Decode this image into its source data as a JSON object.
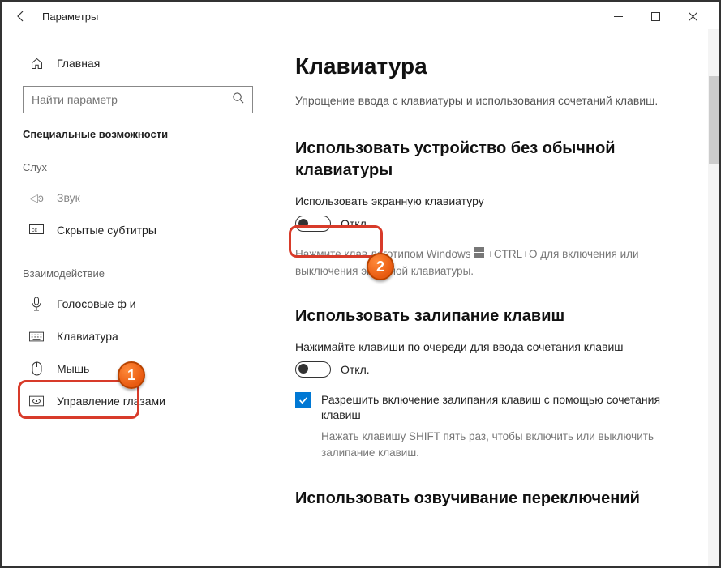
{
  "titlebar": {
    "title": "Параметры"
  },
  "sidebar": {
    "home": "Главная",
    "search_placeholder": "Найти параметр",
    "group": "Специальные возможности",
    "sections": {
      "hearing": "Слух",
      "interaction": "Взаимодействие"
    },
    "items": {
      "zvuk": "Звук",
      "captions": "Скрытые субтитры",
      "voice": "Голосовые ф        и",
      "keyboard": "Клавиатура",
      "mouse": "Мышь",
      "eye": "Управление глазами"
    }
  },
  "main": {
    "heading": "Клавиатура",
    "sub": "Упрощение ввода с клавиатуры и использования сочетаний клавиш.",
    "sec1": {
      "title": "Использовать устройство без обычной клавиатуры",
      "opt": "Использовать экранную клавиатуру",
      "toggle": "Откл.",
      "hint1": "Нажмите клав           логотипом Windows",
      "hint2": " +CTRL+O для включения или выключения экранной клавиатуры."
    },
    "sec2": {
      "title": "Использовать залипание клавиш",
      "opt": "Нажимайте клавиши по очереди для ввода сочетания клавиш",
      "toggle": "Откл.",
      "cb": "Разрешить включение залипания клавиш с помощью сочетания клавиш",
      "hint": "Нажать клавишу SHIFT пять раз, чтобы включить или выключить залипание клавиш."
    },
    "sec3": {
      "title": "Использовать озвучивание переключений"
    }
  },
  "badges": {
    "one": "1",
    "two": "2"
  }
}
